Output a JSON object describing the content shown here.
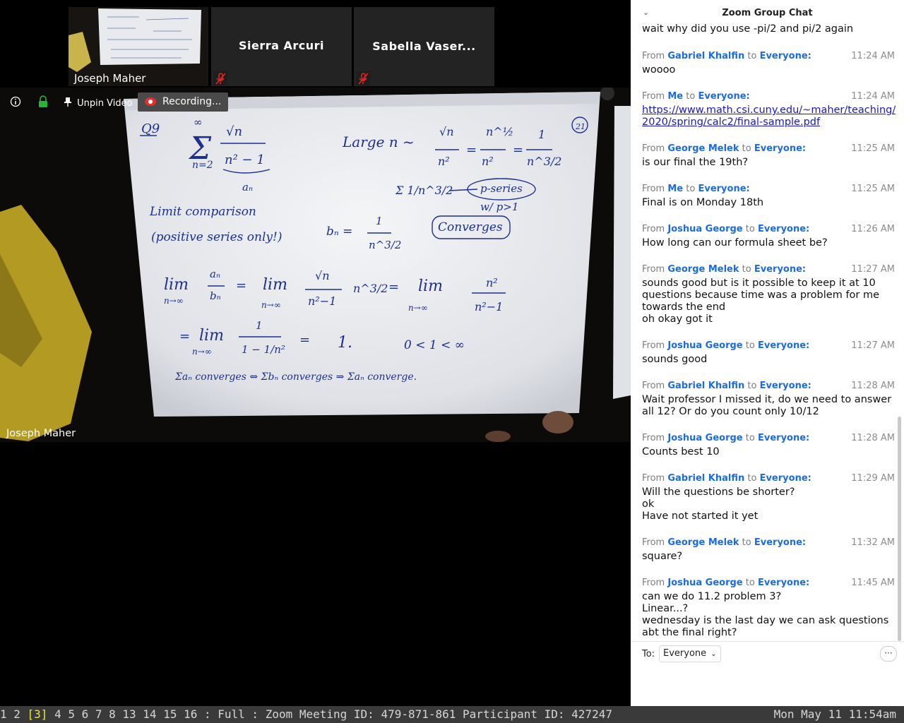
{
  "participants": {
    "thumb_name": "Joseph Maher",
    "tiles": [
      "Sierra Arcuri",
      "Sabella Vaser..."
    ],
    "main_name": "Joseph Maher"
  },
  "toolbar": {
    "unpin_label": "Unpin Video",
    "recording_label": "Recording..."
  },
  "whiteboard": {
    "problem": "Q9",
    "page_no": "21",
    "sigma": "Σ",
    "sum_top": "∞",
    "sum_bottom": "n=2",
    "numer": "√n",
    "denom": "n² − 1",
    "an": "aₙ",
    "large": "Large n ~",
    "l_frac1_n": "√n",
    "l_frac1_d": "n²",
    "eq": "=",
    "l_frac2_n": "n^½",
    "l_frac2_d": "n²",
    "l_frac3_n": "1",
    "l_frac3_d": "n^3/2",
    "psum": "Σ 1/n^3/2",
    "pseries": "p-series",
    "pcond": "w/ p>1",
    "conv": "Converges",
    "limcmp": "Limit comparison",
    "positive": "(positive series only!)",
    "bn": "bₙ =",
    "bn_n": "1",
    "bn_d": "n^3/2",
    "lim": "lim",
    "n_inf": "n→∞",
    "r1_a": "aₙ",
    "r1_b": "bₙ",
    "r1_c": "√n",
    "r1_d": "n²−1",
    "r1_e": "n^3/2",
    "r1_f": "n²",
    "r1_g": "n²−1",
    "r2_n": "1",
    "r2_d": "1 − 1/n²",
    "r2_one": "1.",
    "r2_ineq": "0 < 1 < ∞",
    "r3": "Σaₙ converges ⇔ Σbₙ converges     ⇒     Σaₙ converge."
  },
  "chat": {
    "title": "Zoom Group Chat",
    "partial": "wait why did you use -pi/2 and pi/2 again",
    "from_word": "From",
    "to_word": "to",
    "messages": [
      {
        "sender": "Gabriel Khalfin",
        "to": "Everyone:",
        "time": "11:24 AM",
        "lines": [
          "woooo"
        ]
      },
      {
        "sender": "Me",
        "to": "Everyone:",
        "time": "11:24 AM",
        "link": [
          "https://www.math.csi.cuny.edu/~maher/teaching/",
          "2020/spring/calc2/final-sample.pdf"
        ]
      },
      {
        "sender": "George Melek",
        "to": "Everyone:",
        "time": "11:25 AM",
        "lines": [
          "is our final the 19th?"
        ]
      },
      {
        "sender": "Me",
        "to": "Everyone:",
        "time": "11:25 AM",
        "lines": [
          "Final is on Monday 18th"
        ]
      },
      {
        "sender": "Joshua George",
        "to": "Everyone:",
        "time": "11:26 AM",
        "lines": [
          "How long can our formula sheet be?"
        ]
      },
      {
        "sender": "George Melek",
        "to": "Everyone:",
        "time": "11:27 AM",
        "lines": [
          "sounds good but is it possible to keep it at 10",
          "questions because time was a problem for me",
          "towards the end",
          "oh okay got it"
        ]
      },
      {
        "sender": "Joshua George",
        "to": "Everyone:",
        "time": "11:27 AM",
        "lines": [
          "sounds good"
        ]
      },
      {
        "sender": "Gabriel Khalfin",
        "to": "Everyone:",
        "time": "11:28 AM",
        "lines": [
          "Wait professor I missed it, do we need to answer",
          "all 12? Or do you count only 10/12"
        ]
      },
      {
        "sender": "Joshua George",
        "to": "Everyone:",
        "time": "11:28 AM",
        "lines": [
          "Counts best 10"
        ]
      },
      {
        "sender": "Gabriel Khalfin",
        "to": "Everyone:",
        "time": "11:29 AM",
        "lines": [
          "Will the questions be shorter?",
          "ok",
          "Have not started it yet"
        ]
      },
      {
        "sender": "George Melek",
        "to": "Everyone:",
        "time": "11:32 AM",
        "lines": [
          "square?"
        ]
      },
      {
        "sender": "Joshua George",
        "to": "Everyone:",
        "time": "11:45 AM",
        "lines": [
          "can we do 11.2 problem 3?",
          "Linear...?",
          "wednesday is the last day we can ask questions",
          "abt the final right?"
        ]
      }
    ],
    "to_label": "To:",
    "recipient": "Everyone",
    "more": "···"
  },
  "statusbar": {
    "workspaces_before": "1 2 ",
    "current": "[3]",
    "workspaces_after": " 4 5 6 7 8 13 14 15 16 : Full : Zoom Meeting ID: 479-871-861 Participant ID: 427247",
    "clock": "Mon May 11 11:54am"
  },
  "colors": {
    "ink": "#1d2f8f",
    "chat_sender": "#1d6be0",
    "link": "#1717d1",
    "status_current": "#e8e838",
    "mute": "#e02828",
    "lock": "#27b53a",
    "record": "#e23030"
  }
}
